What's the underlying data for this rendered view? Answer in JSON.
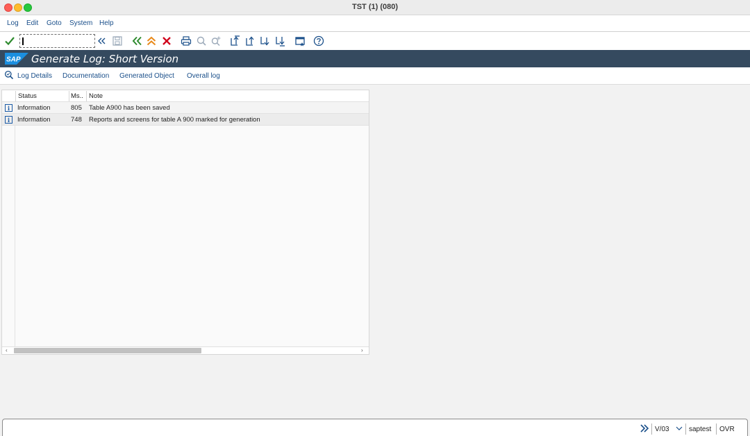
{
  "window": {
    "title": "TST (1) (080)"
  },
  "menu": {
    "items": [
      "Log",
      "Edit",
      "Goto",
      "System",
      "Help"
    ]
  },
  "toolbar": {
    "command_value": "",
    "icons": [
      "check-icon",
      "back-nav-icon",
      "save-icon",
      "back-icon",
      "exit-icon",
      "cancel-icon",
      "print-icon",
      "find-icon",
      "find-next-icon",
      "first-page-icon",
      "previous-page-icon",
      "next-page-icon",
      "last-page-icon",
      "layout-icon",
      "help-icon"
    ]
  },
  "header": {
    "logo": "SAP",
    "title": "Generate Log: Short Version"
  },
  "appbar": {
    "buttons": [
      "Log Details",
      "Documentation",
      "Generated Object",
      "Overall log"
    ]
  },
  "table": {
    "columns": [
      "Status",
      "Ms..",
      "Note"
    ],
    "rows": [
      {
        "status": "Information",
        "ms": "805",
        "note": "Table A900 has been saved"
      },
      {
        "status": "Information",
        "ms": "748",
        "note": "Reports and screens for table A 900 marked for generation"
      }
    ]
  },
  "status": {
    "transaction": "V/03",
    "user": "saptest",
    "mode": "OVR"
  },
  "colors": {
    "header_bg": "#354a5f",
    "link_blue": "#1a4f8a",
    "check_green": "#2e8b2e",
    "cancel_red": "#d0021b",
    "back_green": "#2e8b2e",
    "exit_orange": "#e8891a"
  }
}
